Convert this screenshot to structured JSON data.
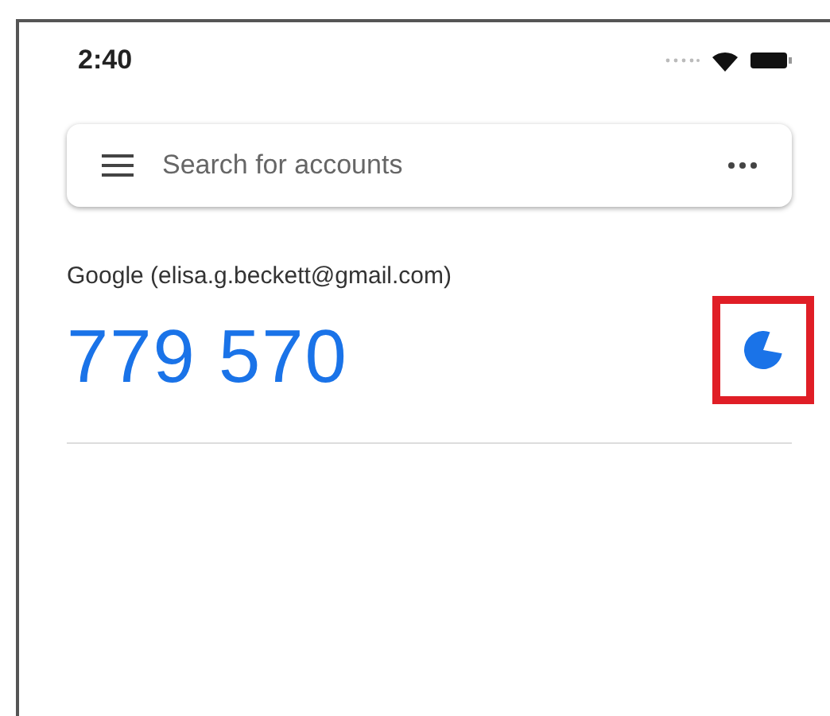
{
  "status_bar": {
    "time": "2:40"
  },
  "search": {
    "placeholder": "Search for accounts"
  },
  "accounts": [
    {
      "name": "Google (elisa.g.beckett@gmail.com)",
      "code": "779 570",
      "timer": {
        "highlighted": true
      }
    }
  ]
}
